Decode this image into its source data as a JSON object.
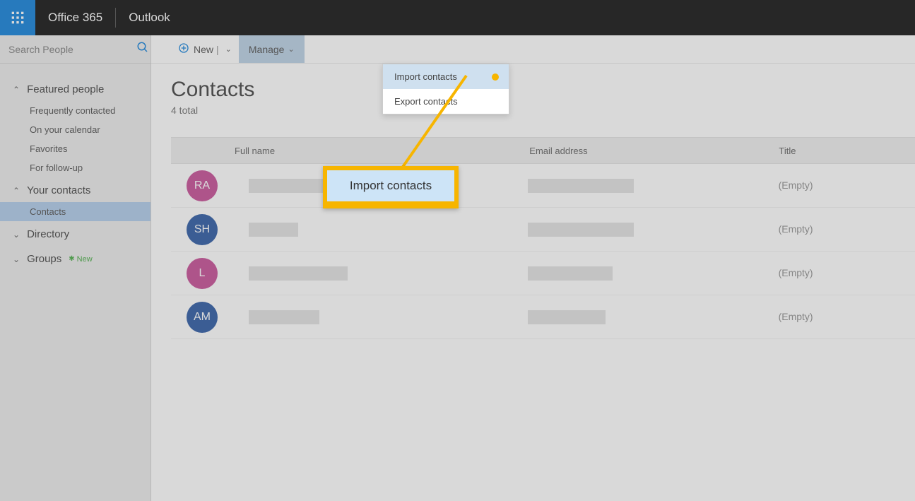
{
  "header": {
    "brand": "Office 365",
    "app": "Outlook"
  },
  "search": {
    "placeholder": "Search People"
  },
  "sidebar": {
    "sections": [
      {
        "label": "Featured people",
        "expanded": true,
        "items": [
          {
            "label": "Frequently contacted"
          },
          {
            "label": "On your calendar"
          },
          {
            "label": "Favorites"
          },
          {
            "label": "For follow-up"
          }
        ]
      },
      {
        "label": "Your contacts",
        "expanded": true,
        "items": [
          {
            "label": "Contacts",
            "active": true
          }
        ]
      },
      {
        "label": "Directory",
        "expanded": false,
        "items": []
      },
      {
        "label": "Groups",
        "expanded": false,
        "badge": "New",
        "items": []
      }
    ]
  },
  "toolbar": {
    "new_label": "New",
    "manage_label": "Manage",
    "dropdown": {
      "import_label": "Import contacts",
      "export_label": "Export contacts"
    }
  },
  "page": {
    "title": "Contacts",
    "subtitle": "4 total"
  },
  "table": {
    "headers": {
      "name": "Full name",
      "email": "Email address",
      "title": "Title"
    },
    "empty_label": "(Empty)",
    "rows": [
      {
        "initials": "RA",
        "color": "pink"
      },
      {
        "initials": "SH",
        "color": "blue"
      },
      {
        "initials": "L",
        "color": "pink"
      },
      {
        "initials": "AM",
        "color": "blue"
      }
    ]
  },
  "callout": {
    "label": "Import contacts"
  },
  "colors": {
    "accent": "#0078d7",
    "highlight": "#f7b500",
    "avatar_pink": "#c2418f",
    "avatar_blue": "#1e4e9c"
  }
}
